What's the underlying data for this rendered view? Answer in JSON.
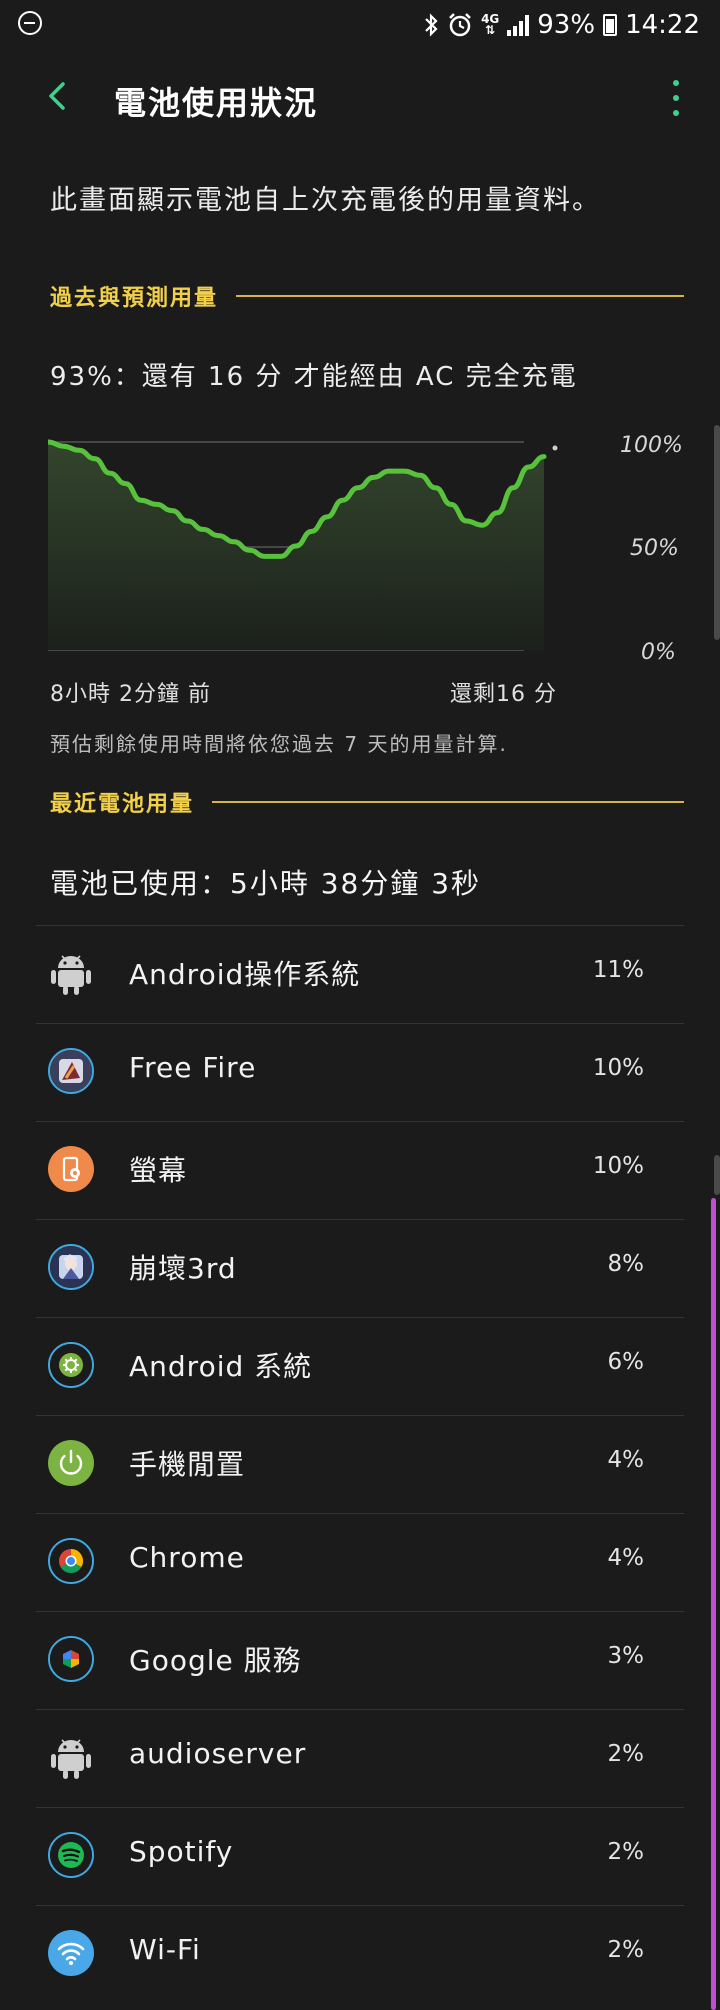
{
  "status_bar": {
    "network": "4G",
    "battery": "93%",
    "time": "14:22"
  },
  "header": {
    "title": "電池使用狀況"
  },
  "description": "此畫面顯示電池自上次充電後的用量資料。",
  "history_section": {
    "title": "過去與預測用量",
    "charge_status": "93%：還有 16 分 才能經由 AC 完全充電",
    "y_labels": [
      "100%",
      "50%",
      "0%"
    ],
    "x_start": "8小時 2分鐘 前",
    "x_end": "還剩16 分",
    "estimate_note": "預估剩餘使用時間將依您過去 7 天的用量計算."
  },
  "chart_data": {
    "type": "area",
    "x_start": "8小時 2分鐘 前",
    "x_end": "還剩16 分",
    "ylim": [
      0,
      100
    ],
    "y_ticks": [
      "0%",
      "50%",
      "100%"
    ],
    "values": [
      100,
      98,
      96,
      92,
      85,
      80,
      72,
      70,
      67,
      62,
      58,
      55,
      52,
      48,
      45,
      45,
      50,
      57,
      64,
      72,
      78,
      83,
      86,
      86,
      84,
      78,
      70,
      62,
      60,
      66,
      78,
      88,
      93
    ],
    "colors": {
      "line": "#58c23c",
      "fill": "#2a3a25"
    }
  },
  "usage_section": {
    "title": "最近電池用量",
    "total_used": "電池已使用：5小時 38分鐘 3秒"
  },
  "apps": [
    {
      "name": "Android操作系統",
      "percent": "11%",
      "icon": "android-icon"
    },
    {
      "name": "Free Fire",
      "percent": "10%",
      "icon": "free-fire-icon"
    },
    {
      "name": "螢幕",
      "percent": "10%",
      "icon": "screen-icon"
    },
    {
      "name": "崩壞3rd",
      "percent": "8%",
      "icon": "honkai-icon"
    },
    {
      "name": "Android 系統",
      "percent": "6%",
      "icon": "android-system-icon"
    },
    {
      "name": "手機閒置",
      "percent": "4%",
      "icon": "power-idle-icon"
    },
    {
      "name": "Chrome",
      "percent": "4%",
      "icon": "chrome-icon"
    },
    {
      "name": "Google 服務",
      "percent": "3%",
      "icon": "google-services-icon"
    },
    {
      "name": "audioserver",
      "percent": "2%",
      "icon": "android-icon"
    },
    {
      "name": "Spotify",
      "percent": "2%",
      "icon": "spotify-icon"
    },
    {
      "name": "Wi-Fi",
      "percent": "2%",
      "icon": "wifi-icon"
    }
  ]
}
